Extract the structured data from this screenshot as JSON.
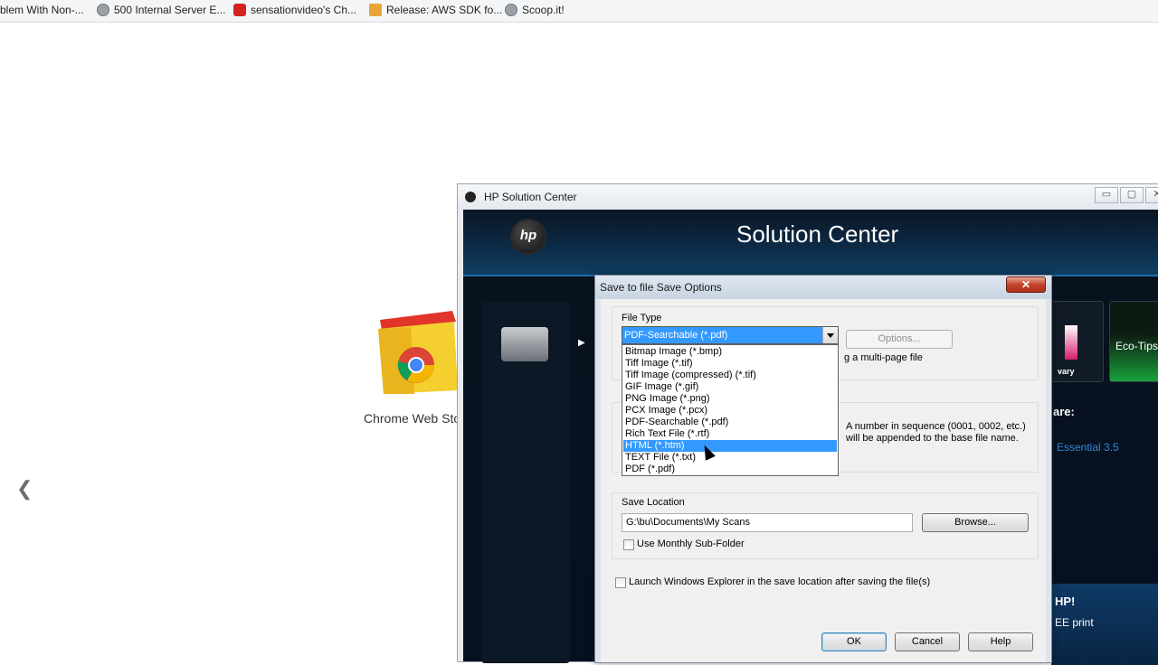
{
  "bookmarks": [
    {
      "label": "blem With Non-...",
      "icon": "globe-icon"
    },
    {
      "label": "500 Internal Server E...",
      "icon": "globe-icon"
    },
    {
      "label": "sensationvideo's Ch...",
      "icon": "youtube-icon"
    },
    {
      "label": "Release: AWS SDK fo...",
      "icon": "package-icon"
    },
    {
      "label": "Scoop.it!",
      "icon": "globe-icon"
    }
  ],
  "chrome": {
    "app_label": "Chrome Web Sto",
    "nav_prev": "❮"
  },
  "hp_window": {
    "title": "HP Solution Center",
    "heading": "Solution Center",
    "logo_text": "hp",
    "tile_text": "vary",
    "eco_tile": "Eco-Tips",
    "software_label": "are:",
    "essential_link": "Essential 3.5",
    "promo_heading": "HP!",
    "promo_text": "EE print",
    "win_minimize": "▭",
    "win_maximize": "▢",
    "win_close": "✕"
  },
  "dialog": {
    "title": "Save to file Save Options",
    "close_label": "✕",
    "file_type_label": "File Type",
    "file_type_value": "PDF-Searchable (*.pdf)",
    "options_button": "Options...",
    "multipage_text": "g a multi-page file",
    "sequence_text_1": "A number in sequence (0001, 0002, etc.)",
    "sequence_text_2": "will be appended to the base file name.",
    "file_type_options": [
      "Bitmap Image (*.bmp)",
      "Tiff Image (*.tif)",
      "Tiff Image (compressed) (*.tif)",
      "GIF Image (*.gif)",
      "PNG Image (*.png)",
      "PCX Image (*.pcx)",
      "PDF-Searchable (*.pdf)",
      "Rich Text File (*.rtf)",
      "HTML (*.htm)",
      "TEXT File (*.txt)",
      "PDF (*.pdf)"
    ],
    "highlighted_option": "HTML (*.htm)",
    "save_location_label": "Save Location",
    "save_location_value": "G:\\bu\\Documents\\My Scans",
    "browse_button": "Browse...",
    "monthly_subfolder_label": "Use Monthly Sub-Folder",
    "monthly_subfolder_checked": false,
    "launch_explorer_label": "Launch Windows Explorer in the save location after saving the file(s)",
    "launch_explorer_checked": false,
    "ok_button": "OK",
    "cancel_button": "Cancel",
    "help_button": "Help"
  },
  "colors": {
    "selection": "#3399ff",
    "hp_header": "#0c2a44",
    "eco_green": "#17a23a",
    "link_blue": "#2f86d8"
  }
}
